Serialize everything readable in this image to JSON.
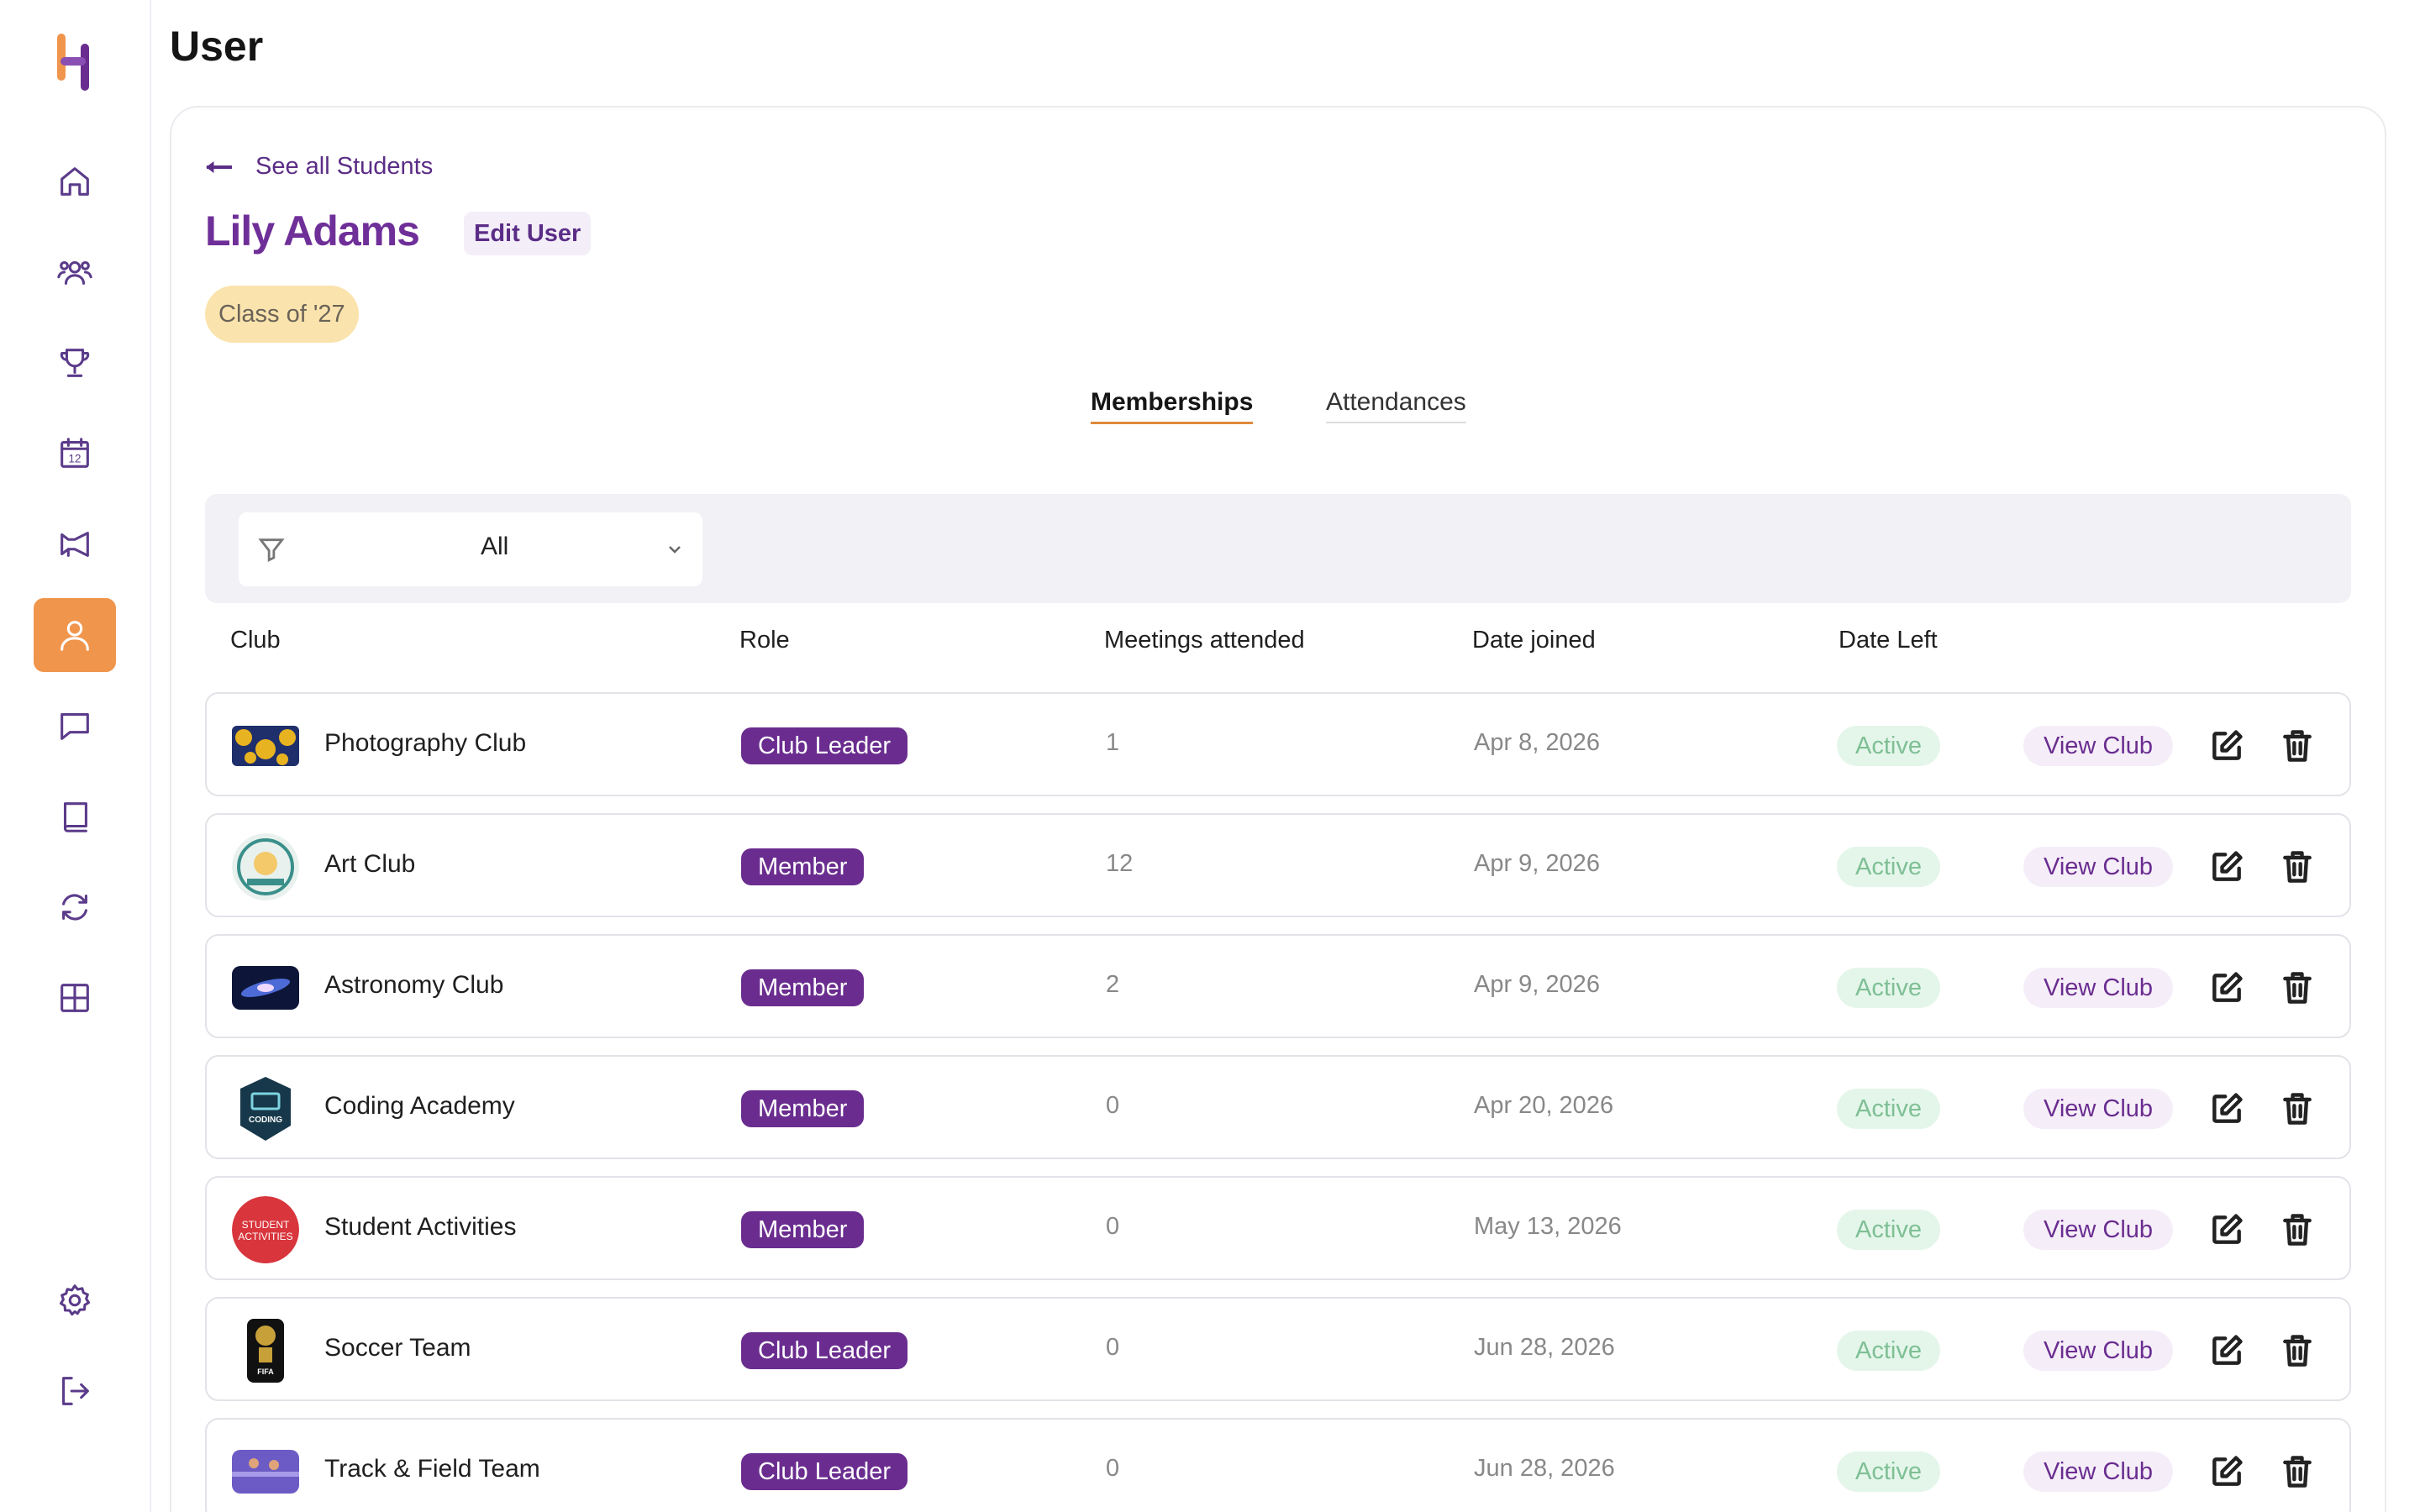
{
  "page": {
    "title": "User"
  },
  "sidebar": {
    "items": [
      {
        "icon": "home-icon"
      },
      {
        "icon": "users-icon"
      },
      {
        "icon": "trophy-icon"
      },
      {
        "icon": "calendar-icon",
        "calendar_day": "12"
      },
      {
        "icon": "megaphone-icon"
      },
      {
        "icon": "user-icon",
        "active": true
      },
      {
        "icon": "chat-icon"
      },
      {
        "icon": "book-icon"
      },
      {
        "icon": "sync-icon"
      },
      {
        "icon": "grid-icon"
      },
      {
        "icon": "settings-icon"
      },
      {
        "icon": "logout-icon"
      }
    ]
  },
  "profile": {
    "back_label": "See all Students",
    "name": "Lily Adams",
    "edit_label": "Edit User",
    "class_badge": "Class of '27"
  },
  "tabs": [
    {
      "label": "Memberships",
      "active": true
    },
    {
      "label": "Attendances",
      "active": false
    }
  ],
  "filter": {
    "selected": "All"
  },
  "table": {
    "headers": [
      "Club",
      "Role",
      "Meetings attended",
      "Date joined",
      "Date Left"
    ],
    "view_label": "View Club",
    "rows": [
      {
        "club": "Photography Club",
        "role": "Club Leader",
        "meetings": "1",
        "joined": "Apr 8, 2026",
        "status": "Active"
      },
      {
        "club": "Art Club",
        "role": "Member",
        "meetings": "12",
        "joined": "Apr 9, 2026",
        "status": "Active"
      },
      {
        "club": "Astronomy Club",
        "role": "Member",
        "meetings": "2",
        "joined": "Apr 9, 2026",
        "status": "Active"
      },
      {
        "club": "Coding Academy",
        "role": "Member",
        "meetings": "0",
        "joined": "Apr 20, 2026",
        "status": "Active"
      },
      {
        "club": "Student Activities",
        "role": "Member",
        "meetings": "0",
        "joined": "May 13, 2026",
        "status": "Active"
      },
      {
        "club": "Soccer Team",
        "role": "Club Leader",
        "meetings": "0",
        "joined": "Jun 28, 2026",
        "status": "Active"
      },
      {
        "club": "Track & Field Team",
        "role": "Club Leader",
        "meetings": "0",
        "joined": "Jun 28, 2026",
        "status": "Active"
      }
    ]
  },
  "logo_texts": {
    "coding": "CODING",
    "student_activities_1": "STUDENT",
    "student_activities_2": "ACTIVITIES",
    "soccer": "FIFA"
  },
  "colors": {
    "brand_purple": "#6a2d8f",
    "accent_orange": "#f0954c",
    "active_green": "#7fbf95",
    "badge_yellow": "#fbe3ad"
  }
}
